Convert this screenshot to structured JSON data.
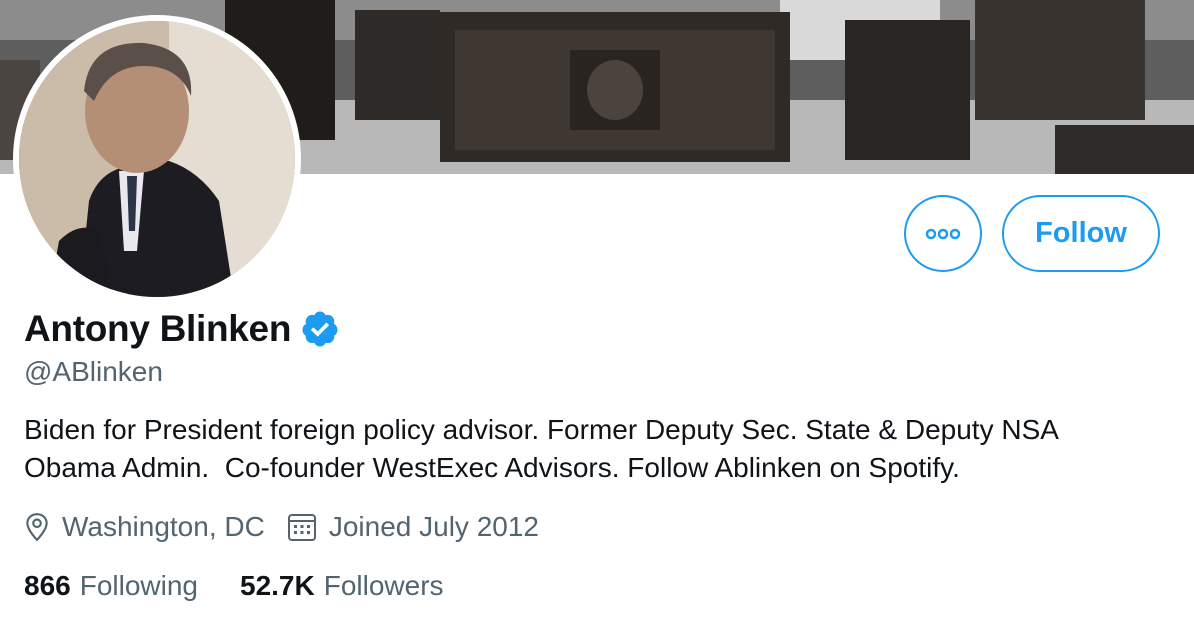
{
  "profile": {
    "name": "Antony Blinken",
    "handle": "@ABlinken",
    "bio": "Biden for President foreign policy advisor. Former Deputy Sec. State & Deputy NSA\nObama Admin.  Co-founder WestExec Advisors. Follow Ablinken on Spotify.",
    "location": "Washington, DC",
    "joined": "Joined July 2012",
    "following_count": "866",
    "following_label": "Following",
    "followers_count": "52.7K",
    "followers_label": "Followers",
    "verified": true
  },
  "actions": {
    "follow_label": "Follow",
    "more_icon": "more-icon"
  },
  "colors": {
    "accent": "#1d9bf0",
    "secondary_text": "#536471",
    "primary_text": "#0f1419"
  }
}
